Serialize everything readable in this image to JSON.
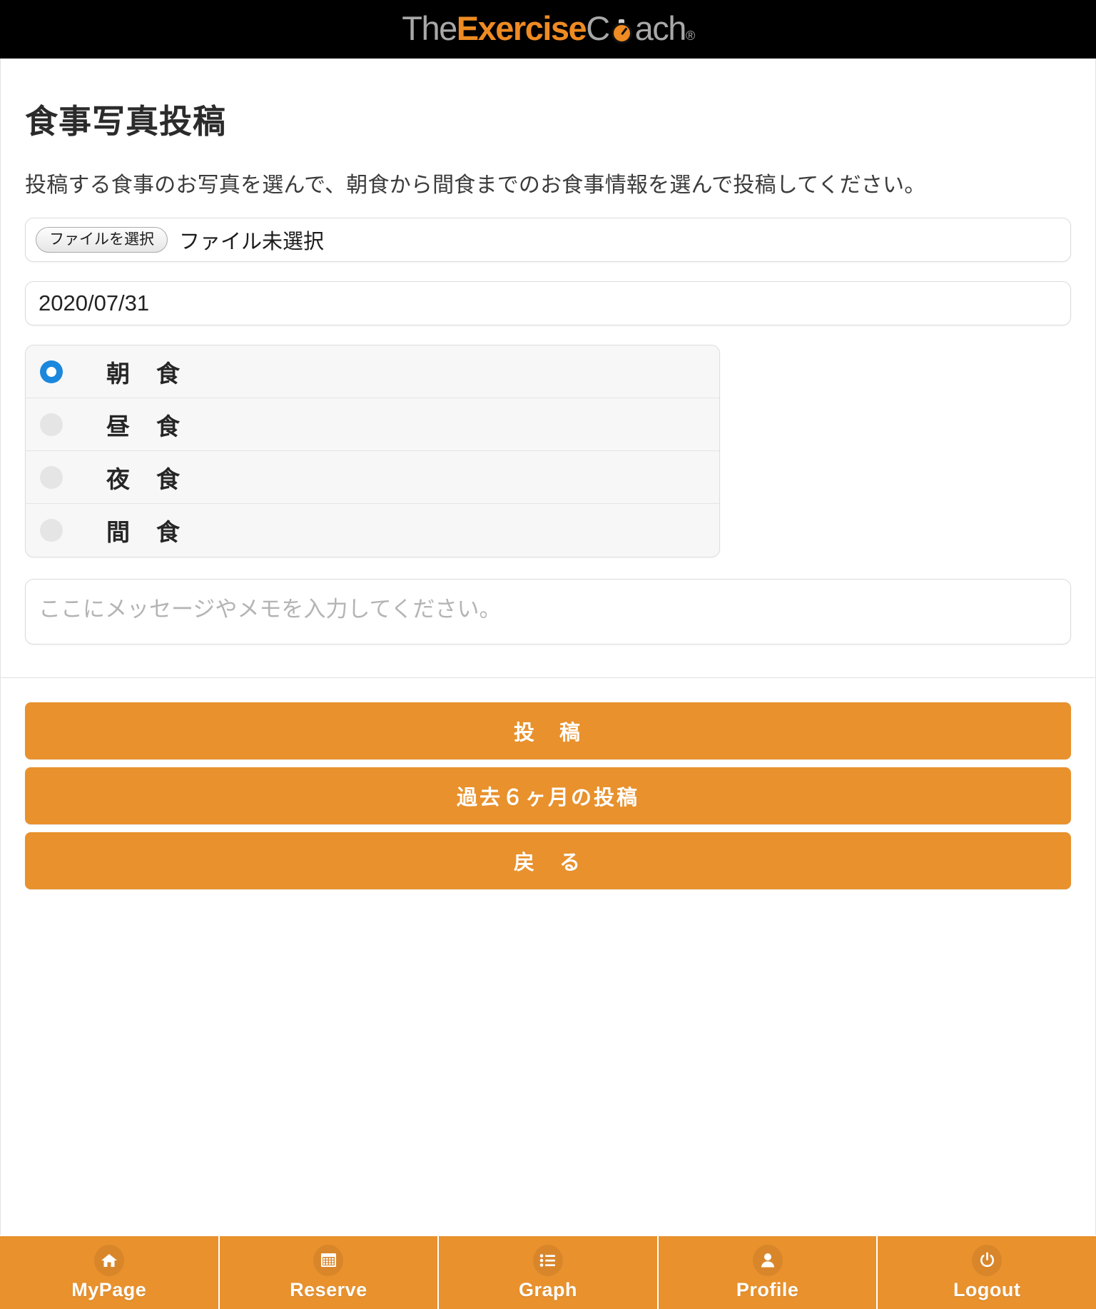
{
  "brand": {
    "logo_parts": {
      "the": "The",
      "exercise": "Exercise",
      "c": "C",
      "ach": "ach",
      "registered": "®"
    },
    "colors": {
      "accent_orange": "#e8912d",
      "logo_orange": "#ef8b22",
      "logo_gray": "#a8a8a8",
      "header_black": "#000000",
      "radio_selected_blue": "#1b87dd"
    }
  },
  "main": {
    "title": "食事写真投稿",
    "description": "投稿する食事のお写真を選んで、朝食から間食までのお食事情報を選んで投稿してください。",
    "file_field": {
      "button_label": "ファイルを選択",
      "status_text": "ファイル未選択"
    },
    "date_field": {
      "value": "2020/07/31"
    },
    "meal_options": [
      {
        "label": "朝　食",
        "selected": true
      },
      {
        "label": "昼　食",
        "selected": false
      },
      {
        "label": "夜　食",
        "selected": false
      },
      {
        "label": "間　食",
        "selected": false
      }
    ],
    "memo_field": {
      "placeholder": "ここにメッセージやメモを入力してください。",
      "value": ""
    },
    "actions": [
      {
        "label": "投　稿"
      },
      {
        "label": "過去６ヶ月の投稿"
      },
      {
        "label": "戻　る"
      }
    ]
  },
  "bottom_nav": {
    "items": [
      {
        "label": "MyPage",
        "icon": "home-icon"
      },
      {
        "label": "Reserve",
        "icon": "calendar-icon"
      },
      {
        "label": "Graph",
        "icon": "list-icon"
      },
      {
        "label": "Profile",
        "icon": "person-icon"
      },
      {
        "label": "Logout",
        "icon": "power-icon"
      }
    ]
  }
}
